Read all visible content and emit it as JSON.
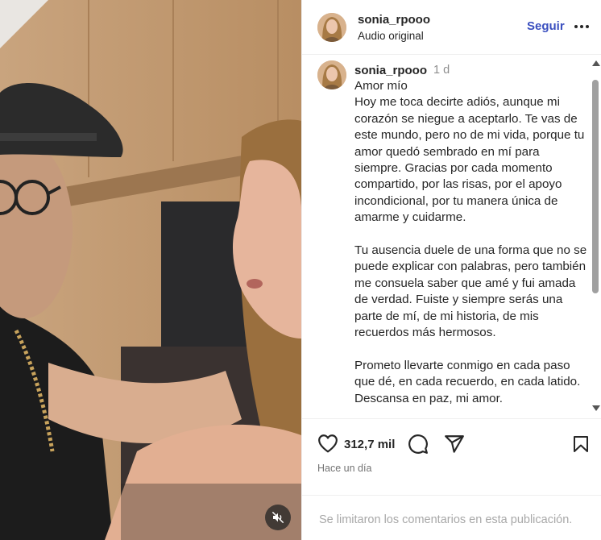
{
  "header": {
    "username": "sonia_rpooo",
    "audio_label": "Audio original",
    "follow_label": "Seguir",
    "more_icon": "more-horizontal-icon"
  },
  "caption": {
    "username": "sonia_rpooo",
    "time": "1 d",
    "text": "Amor mío\nHoy me toca decirte adiós, aunque mi corazón se niegue a aceptarlo. Te vas de este mundo, pero no de mi vida, porque tu amor quedó sembrado en mí para siempre. Gracias por cada momento compartido, por las risas, por el apoyo incondicional, por tu manera única de amarme y cuidarme.\n\nTu ausencia duele de una forma que no se puede explicar con palabras, pero también me consuela saber que amé y fui amada de verdad. Fuiste y siempre serás una parte de mí, de mi historia, de mis recuerdos más hermosos.\n\nPrometo llevarte conmigo en cada paso que dé, en cada recuerdo, en cada latido. Descansa en paz, mi amor."
  },
  "actions": {
    "likes": "312,7 mil",
    "posted_ago": "Hace un día"
  },
  "comments": {
    "limited_text": "Se limitaron los comentarios en esta publicación."
  },
  "icons": {
    "like": "heart-icon",
    "comment": "comment-bubble-icon",
    "share": "paper-plane-icon",
    "save": "bookmark-icon",
    "mute": "speaker-muted-icon"
  }
}
